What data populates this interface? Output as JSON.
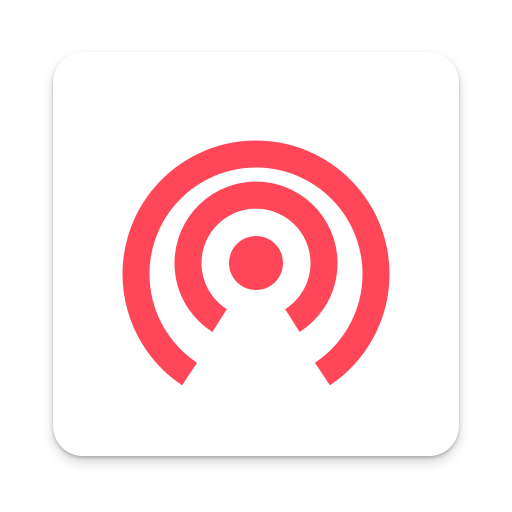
{
  "icon": {
    "name": "broadcast-signal-icon",
    "accent_color": "#ff4759",
    "tile_color": "#ffffff"
  }
}
